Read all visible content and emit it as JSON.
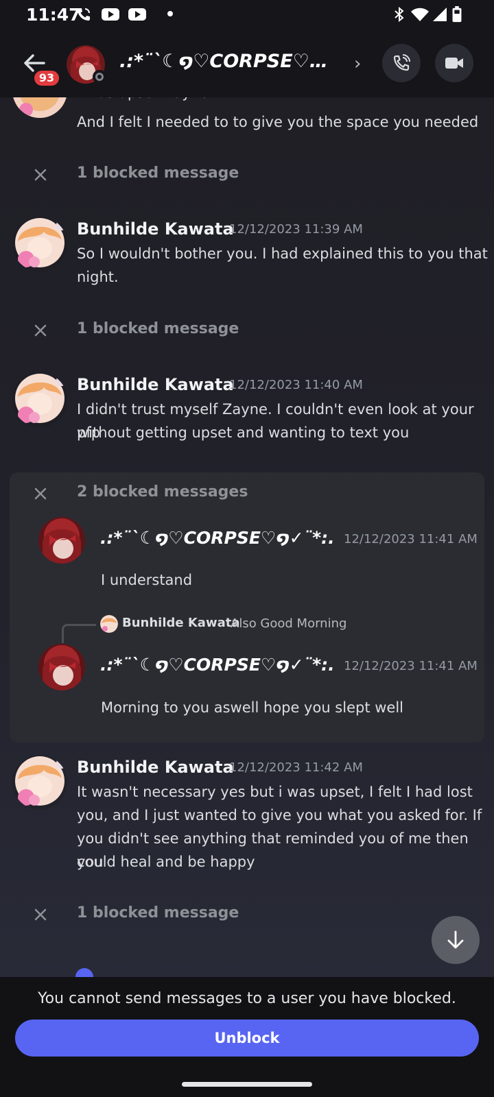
{
  "status_bar": {
    "time": "11:47",
    "icons": [
      "phone-call-icon",
      "youtube-icon",
      "youtube-icon",
      "dot-icon",
      "bluetooth-icon",
      "wifi-icon",
      "signal-icon",
      "battery-icon"
    ]
  },
  "header": {
    "unread_badge": "93",
    "channel_name": ".:*¨`☾໑♡CORPSE♡…",
    "buttons": [
      "back-icon",
      "call-icon",
      "video-icon"
    ]
  },
  "messages": {
    "top_partial_line": "I was upset Zayne",
    "top_line": "And I felt I needed to to give you the space you needed",
    "blocked_1": "1 blocked message",
    "msg1": {
      "author": "Bunhilde Kawata",
      "time": "12/12/2023 11:39 AM",
      "line1": "So I wouldn't bother you. I had explained this to you that",
      "line2": "night."
    },
    "blocked_2": "1 blocked message",
    "msg2": {
      "author": "Bunhilde Kawata",
      "time": "12/12/2023 11:40 AM",
      "line1": "I didn't trust myself Zayne. I couldn't even look at your pfp",
      "line2": "without getting upset and wanting to text you"
    },
    "blocked_group": {
      "label": "2 blocked messages",
      "m1": {
        "author": ".:*¨`☾໑♡CORPSE♡໑✓¨*:.",
        "time": "12/12/2023 11:41 AM",
        "text": "I understand"
      },
      "reply": {
        "author": "Bunhilde Kawata",
        "text": "Also Good Morning"
      },
      "m2": {
        "author": ".:*¨`☾໑♡CORPSE♡໑✓¨*:.",
        "time": "12/12/2023 11:41 AM",
        "text": "Morning to you aswell hope you slept well"
      }
    },
    "msg3": {
      "author": "Bunhilde Kawata",
      "time": "12/12/2023 11:42 AM",
      "line1": "It wasn't necessary yes but i was upset, I felt I had lost",
      "line2": "you, and I just wanted to give you what you asked for. If",
      "line3": "you didn't see anything that reminded you of me then you",
      "line4": "could heal and be happy"
    },
    "blocked_3": "1 blocked message"
  },
  "footer": {
    "notice": "You cannot send messages to a user you have blocked.",
    "unblock_label": "Unblock"
  },
  "colors": {
    "accent": "#5865f2",
    "badge": "#e23c3e",
    "background": "#1f1e25"
  }
}
